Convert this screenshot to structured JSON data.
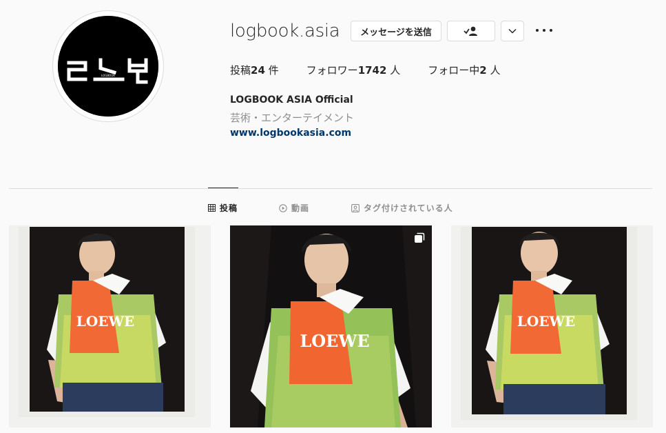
{
  "profile": {
    "username": "logbook.asia",
    "avatar_logo_text": "LOGBOOK ENTERTAINMENT",
    "full_name": "LOGBOOK ASIA Official",
    "category": "芸術・エンターテイメント",
    "website": "www.logbookasia.com"
  },
  "actions": {
    "message_label": "メッセージを送信",
    "following_icon": "person-check-icon",
    "dropdown_icon": "chevron-down-icon",
    "more_icon": "more-horizontal-icon"
  },
  "stats": {
    "posts_label": "投稿",
    "posts_count": "24",
    "posts_unit": " 件",
    "followers_label": "フォロワー",
    "followers_count": "1742",
    "followers_unit": " 人",
    "following_label": "フォロー中",
    "following_count": "2",
    "following_unit": " 人"
  },
  "tabs": [
    {
      "label": "投稿",
      "icon": "grid-icon",
      "active": true
    },
    {
      "label": "動画",
      "icon": "play-icon",
      "active": false
    },
    {
      "label": "タグ付けされている人",
      "icon": "tagged-person-icon",
      "active": false
    }
  ],
  "posts": [
    {
      "type": "photo",
      "shirt_text": "LOEWE"
    },
    {
      "type": "carousel",
      "shirt_text": "LOEWE",
      "icon": "multiple-posts-icon"
    },
    {
      "type": "photo",
      "shirt_text": "LOEWE"
    }
  ],
  "colors": {
    "background": "#fafafa",
    "text": "#262626",
    "secondary_text": "#8e8e8e",
    "link": "#00376b",
    "border": "#dbdbdb",
    "shirt_green": "#9cc35a",
    "shirt_orange": "#f0662b"
  }
}
